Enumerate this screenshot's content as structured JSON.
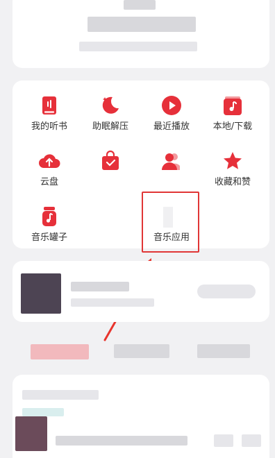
{
  "colors": {
    "accent": "#e6303a",
    "highlight_box": "#e03535",
    "arrow": "#e8342c"
  },
  "shortcuts": [
    {
      "label": "我的听书",
      "icon": "book-icon"
    },
    {
      "label": "助眠解压",
      "icon": "moon-icon"
    },
    {
      "label": "最近播放",
      "icon": "play-icon"
    },
    {
      "label": "本地/下载",
      "icon": "local-music-icon"
    },
    {
      "label": "云盘",
      "icon": "cloud-upload-icon"
    },
    {
      "label": "",
      "icon": "shopping-bag-icon"
    },
    {
      "label": "",
      "icon": "users-icon"
    },
    {
      "label": "收藏和赞",
      "icon": "star-icon"
    },
    {
      "label": "音乐罐子",
      "icon": "music-jar-icon"
    },
    {
      "label": "音乐应用",
      "icon": "app-icon"
    }
  ]
}
